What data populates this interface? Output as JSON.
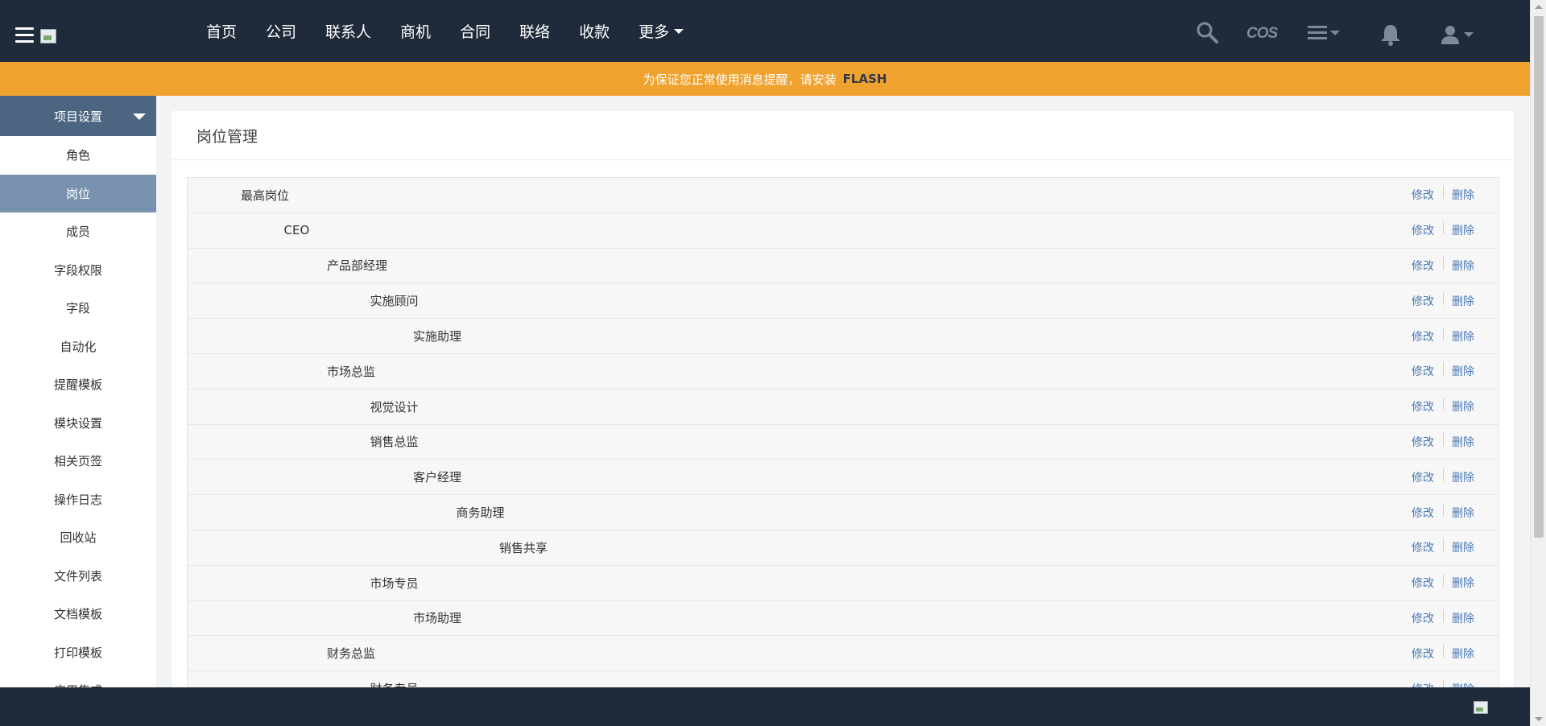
{
  "header": {
    "nav": [
      {
        "label": "首页"
      },
      {
        "label": "公司"
      },
      {
        "label": "联系人"
      },
      {
        "label": "商机"
      },
      {
        "label": "合同"
      },
      {
        "label": "联络"
      },
      {
        "label": "收款"
      }
    ],
    "more_label": "更多",
    "cos_label": "COS",
    "icons": [
      "menu-icon",
      "logo-image",
      "search-icon",
      "cos-icon",
      "list-menu-icon",
      "bell-icon",
      "user-icon"
    ]
  },
  "notice": {
    "text": "为保证您正常使用消息提醒，请安装",
    "highlight": "FLASH"
  },
  "sidebar": {
    "header": "项目设置",
    "items": [
      {
        "label": "角色"
      },
      {
        "label": "岗位",
        "active": true
      },
      {
        "label": "成员"
      },
      {
        "label": "字段权限"
      },
      {
        "label": "字段"
      },
      {
        "label": "自动化"
      },
      {
        "label": "提醒模板"
      },
      {
        "label": "模块设置"
      },
      {
        "label": "相关页签"
      },
      {
        "label": "操作日志"
      },
      {
        "label": "回收站"
      },
      {
        "label": "文件列表"
      },
      {
        "label": "文档模板"
      },
      {
        "label": "打印模板"
      },
      {
        "label": "应用集成"
      }
    ]
  },
  "main": {
    "title": "岗位管理",
    "edit_label": "修改",
    "delete_label": "删除",
    "positions": [
      {
        "name": "最高岗位",
        "level": 0
      },
      {
        "name": "CEO",
        "level": 1
      },
      {
        "name": "产品部经理",
        "level": 2
      },
      {
        "name": "实施顾问",
        "level": 3
      },
      {
        "name": "实施助理",
        "level": 4
      },
      {
        "name": "市场总监",
        "level": 2
      },
      {
        "name": "视觉设计",
        "level": 3
      },
      {
        "name": "销售总监",
        "level": 3
      },
      {
        "name": "客户经理",
        "level": 4
      },
      {
        "name": "商务助理",
        "level": 5
      },
      {
        "name": "销售共享",
        "level": 6
      },
      {
        "name": "市场专员",
        "level": 3
      },
      {
        "name": "市场助理",
        "level": 4
      },
      {
        "name": "财务总监",
        "level": 2
      },
      {
        "name": "财务专员",
        "level": 3
      }
    ]
  },
  "colors": {
    "topbar": "#1f2a3a",
    "notice": "#f0a22f",
    "sidebar_header": "#4c6580",
    "sidebar_active": "#7891ae",
    "link": "#4a79b4"
  }
}
